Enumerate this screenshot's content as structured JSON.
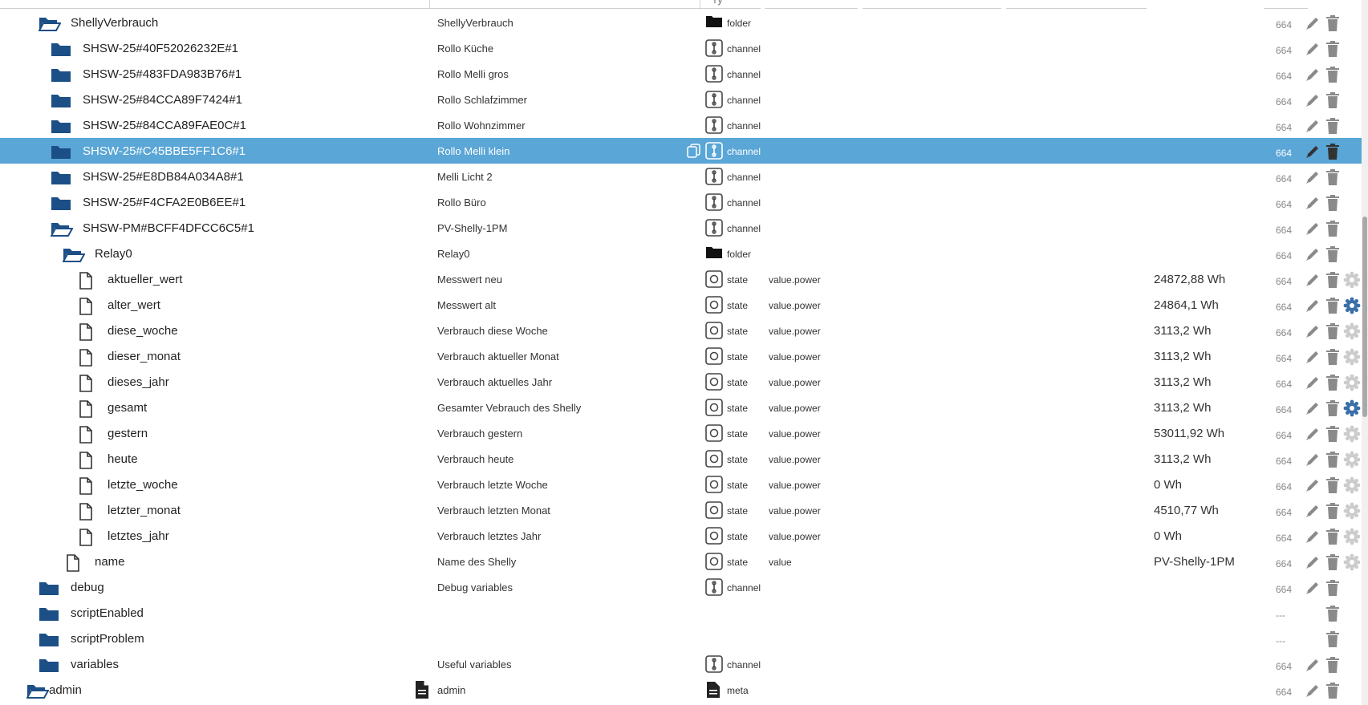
{
  "header": {
    "col_type": "Ty"
  },
  "colors": {
    "folder": "#1c4f86",
    "selected_bg": "#5aa6d6",
    "gear_active": "#3a6fa8",
    "gear_inactive": "#cccccc",
    "icon_gray": "#8a8a8a"
  },
  "rows": [
    {
      "indent": 1,
      "icon": "folder-open-icon",
      "name": "ShellyVerbrauch",
      "common": "ShellyVerbrauch",
      "type_icon": "folder-black-icon",
      "type": "folder",
      "role": "",
      "value": "",
      "acl": "664",
      "gear": "none"
    },
    {
      "indent": 2,
      "icon": "folder-icon",
      "name": "SHSW-25#40F52026232E#1",
      "common": "Rollo Küche",
      "type_icon": "channel-icon",
      "type": "channel",
      "role": "",
      "value": "",
      "acl": "664",
      "gear": "none"
    },
    {
      "indent": 2,
      "icon": "folder-icon",
      "name": "SHSW-25#483FDA983B76#1",
      "common": "Rollo Melli gros",
      "type_icon": "channel-icon",
      "type": "channel",
      "role": "",
      "value": "",
      "acl": "664",
      "gear": "none"
    },
    {
      "indent": 2,
      "icon": "folder-icon",
      "name": "SHSW-25#84CCA89F7424#1",
      "common": "Rollo Schlafzimmer",
      "type_icon": "channel-icon",
      "type": "channel",
      "role": "",
      "value": "",
      "acl": "664",
      "gear": "none"
    },
    {
      "indent": 2,
      "icon": "folder-icon",
      "name": "SHSW-25#84CCA89FAE0C#1",
      "common": "Rollo Wohnzimmer",
      "type_icon": "channel-icon",
      "type": "channel",
      "role": "",
      "value": "",
      "acl": "664",
      "gear": "none"
    },
    {
      "indent": 2,
      "icon": "folder-icon",
      "name": "SHSW-25#C45BBE5FF1C6#1",
      "common": "Rollo Melli klein",
      "type_icon": "channel-icon",
      "type": "channel",
      "role": "",
      "value": "",
      "acl": "664",
      "gear": "none",
      "selected": true
    },
    {
      "indent": 2,
      "icon": "folder-icon",
      "name": "SHSW-25#E8DB84A034A8#1",
      "common": "Melli Licht 2",
      "type_icon": "channel-icon",
      "type": "channel",
      "role": "",
      "value": "",
      "acl": "664",
      "gear": "none"
    },
    {
      "indent": 2,
      "icon": "folder-icon",
      "name": "SHSW-25#F4CFA2E0B6EE#1",
      "common": "Rollo Büro",
      "type_icon": "channel-icon",
      "type": "channel",
      "role": "",
      "value": "",
      "acl": "664",
      "gear": "none"
    },
    {
      "indent": 2,
      "icon": "folder-open-icon",
      "name": "SHSW-PM#BCFF4DFCC6C5#1",
      "common": "PV-Shelly-1PM",
      "type_icon": "channel-icon",
      "type": "channel",
      "role": "",
      "value": "",
      "acl": "664",
      "gear": "none"
    },
    {
      "indent": 3,
      "icon": "folder-open-icon",
      "name": "Relay0",
      "common": "Relay0",
      "type_icon": "folder-black-icon",
      "type": "folder",
      "role": "",
      "value": "",
      "acl": "664",
      "gear": "none"
    },
    {
      "indent": 4,
      "icon": "file-icon",
      "name": "aktueller_wert",
      "common": "Messwert neu",
      "type_icon": "state-icon",
      "type": "state",
      "role": "value.power",
      "value": "24872,88 Wh",
      "acl": "664",
      "gear": "inactive"
    },
    {
      "indent": 4,
      "icon": "file-icon",
      "name": "alter_wert",
      "common": "Messwert alt",
      "type_icon": "state-icon",
      "type": "state",
      "role": "value.power",
      "value": "24864,1 Wh",
      "acl": "664",
      "gear": "active"
    },
    {
      "indent": 4,
      "icon": "file-icon",
      "name": "diese_woche",
      "common": "Verbrauch diese Woche",
      "type_icon": "state-icon",
      "type": "state",
      "role": "value.power",
      "value": "3113,2 Wh",
      "acl": "664",
      "gear": "inactive"
    },
    {
      "indent": 4,
      "icon": "file-icon",
      "name": "dieser_monat",
      "common": "Verbrauch aktueller Monat",
      "type_icon": "state-icon",
      "type": "state",
      "role": "value.power",
      "value": "3113,2 Wh",
      "acl": "664",
      "gear": "inactive"
    },
    {
      "indent": 4,
      "icon": "file-icon",
      "name": "dieses_jahr",
      "common": "Verbrauch aktuelles Jahr",
      "type_icon": "state-icon",
      "type": "state",
      "role": "value.power",
      "value": "3113,2 Wh",
      "acl": "664",
      "gear": "inactive"
    },
    {
      "indent": 4,
      "icon": "file-icon",
      "name": "gesamt",
      "common": "Gesamter Vebrauch des Shelly",
      "type_icon": "state-icon",
      "type": "state",
      "role": "value.power",
      "value": "3113,2 Wh",
      "acl": "664",
      "gear": "active"
    },
    {
      "indent": 4,
      "icon": "file-icon",
      "name": "gestern",
      "common": "Verbrauch gestern",
      "type_icon": "state-icon",
      "type": "state",
      "role": "value.power",
      "value": "53011,92 Wh",
      "acl": "664",
      "gear": "inactive"
    },
    {
      "indent": 4,
      "icon": "file-icon",
      "name": "heute",
      "common": "Verbrauch heute",
      "type_icon": "state-icon",
      "type": "state",
      "role": "value.power",
      "value": "3113,2 Wh",
      "acl": "664",
      "gear": "inactive"
    },
    {
      "indent": 4,
      "icon": "file-icon",
      "name": "letzte_woche",
      "common": "Verbrauch letzte Woche",
      "type_icon": "state-icon",
      "type": "state",
      "role": "value.power",
      "value": "0 Wh",
      "acl": "664",
      "gear": "inactive"
    },
    {
      "indent": 4,
      "icon": "file-icon",
      "name": "letzter_monat",
      "common": "Verbrauch letzten Monat",
      "type_icon": "state-icon",
      "type": "state",
      "role": "value.power",
      "value": "4510,77 Wh",
      "acl": "664",
      "gear": "inactive"
    },
    {
      "indent": 4,
      "icon": "file-icon",
      "name": "letztes_jahr",
      "common": "Verbrauch letztes Jahr",
      "type_icon": "state-icon",
      "type": "state",
      "role": "value.power",
      "value": "0 Wh",
      "acl": "664",
      "gear": "inactive"
    },
    {
      "indent": 3,
      "icon": "file-icon",
      "name": "name",
      "common": "Name des Shelly",
      "type_icon": "state-icon",
      "type": "state",
      "role": "value",
      "value": "PV-Shelly-1PM",
      "acl": "664",
      "gear": "inactive"
    },
    {
      "indent": 1,
      "icon": "folder-icon",
      "name": "debug",
      "common": "Debug variables",
      "type_icon": "channel-icon",
      "type": "channel",
      "role": "",
      "value": "",
      "acl": "664",
      "gear": "none"
    },
    {
      "indent": 1,
      "icon": "folder-icon",
      "name": "scriptEnabled",
      "common": "",
      "type_icon": "",
      "type": "",
      "role": "",
      "value": "",
      "acl": "---",
      "gear": "none",
      "no_edit": true
    },
    {
      "indent": 1,
      "icon": "folder-icon",
      "name": "scriptProblem",
      "common": "",
      "type_icon": "",
      "type": "",
      "role": "",
      "value": "",
      "acl": "---",
      "gear": "none",
      "no_edit": true
    },
    {
      "indent": 1,
      "icon": "folder-icon",
      "name": "variables",
      "common": "Useful variables",
      "type_icon": "channel-icon",
      "type": "channel",
      "role": "",
      "value": "",
      "acl": "664",
      "gear": "none"
    },
    {
      "indent": 0,
      "icon": "folder-open-icon",
      "name": "admin",
      "common": "admin",
      "common_icon": "document-icon",
      "type_icon": "meta-icon",
      "type": "meta",
      "role": "",
      "value": "",
      "acl": "664",
      "gear": "none"
    }
  ]
}
